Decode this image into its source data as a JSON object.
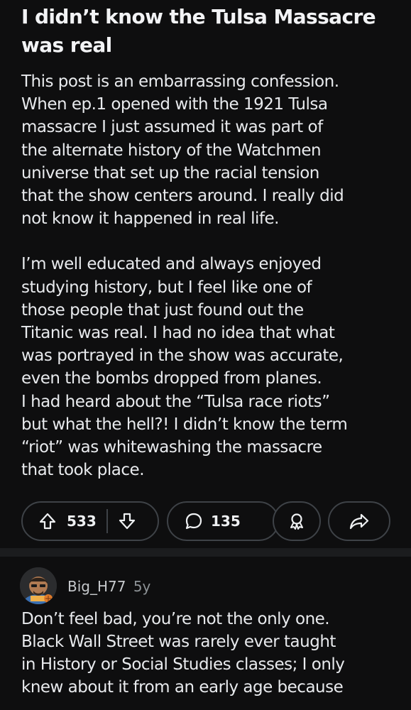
{
  "post": {
    "title_lines": [
      "I didn’t know the Tulsa Massacre",
      "was real"
    ],
    "body_paragraphs": [
      [
        "This post is an embarrassing confession.",
        "When ep.1 opened with the 1921 Tulsa",
        "massacre I just assumed it was part of",
        "the alternate history of the Watchmen",
        "universe that set up the racial tension",
        "that the show centers around. I really did",
        "not know it happened in real life."
      ],
      [
        "I’m well educated and always enjoyed",
        "studying history, but I feel like one of",
        "those people that just found out the",
        "Titanic was real. I had no idea that what",
        "was portrayed in the show was accurate,",
        "even the bombs dropped from planes.",
        "I had heard about the “Tulsa race riots”",
        "but what the hell?! I didn’t know the term",
        "“riot”  was whitewashing the massacre",
        "that took place."
      ]
    ],
    "votes": "533",
    "comments": "135",
    "icons": {
      "upvote": "upvote-arrow-icon",
      "downvote": "downvote-arrow-icon",
      "comment": "comment-bubble-icon",
      "award": "award-icon",
      "share": "share-arrow-icon"
    }
  },
  "comment": {
    "username": "Big_H77",
    "age": "5y",
    "body_lines": [
      "Don’t feel bad, you’re not the only one.",
      "Black Wall Street was rarely ever taught",
      "in History or Social Studies classes; I only",
      "knew about it from an early age because"
    ]
  },
  "colors": {
    "background": "#0e0e0f",
    "text": "#e8eaed",
    "pill_border": "#3e4247",
    "separator": "#1b1c1e",
    "meta_text": "#8d9296"
  }
}
